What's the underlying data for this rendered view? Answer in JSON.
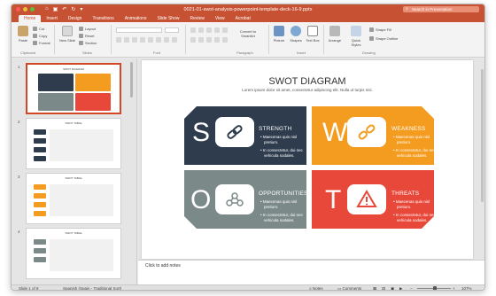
{
  "window": {
    "title": "0021-01-swot-analysis-powerpoint-template-deck-16-9.pptx",
    "search_placeholder": "Search in Presentation"
  },
  "tabs": [
    "Home",
    "Insert",
    "Design",
    "Transitions",
    "Animations",
    "Slide Show",
    "Review",
    "View",
    "Acrobat"
  ],
  "active_tab": "Home",
  "ribbon": {
    "paste": "Paste",
    "cut": "Cut",
    "copy": "Copy",
    "format": "Format",
    "new_slide": "New Slide",
    "layout": "Layout",
    "reset": "Reset",
    "section": "Section",
    "convert_smartart": "Convert to SmartArt",
    "picture": "Picture",
    "shapes": "Shapes",
    "text_box": "Text Box",
    "arrange": "Arrange",
    "quick_styles": "Quick Styles",
    "shape_fill": "Shape Fill",
    "shape_outline": "Shape Outline",
    "groups": {
      "clipboard": "Clipboard",
      "slides": "Slides",
      "font": "Font",
      "paragraph": "Paragraph",
      "insert": "Insert",
      "drawing": "Drawing"
    }
  },
  "thumbnails": [
    {
      "num": "1",
      "title": "SWOT DIAGRAM"
    },
    {
      "num": "2",
      "title": "SWOT TABLE"
    },
    {
      "num": "3",
      "title": "SWOT TABLE"
    },
    {
      "num": "4",
      "title": "SWOT TABLE"
    }
  ],
  "slide": {
    "title": "SWOT DIAGRAM",
    "subtitle": "Lorem ipsum dolor sit amet, consectetur adipiscing elit. Nulla ut turpis nisi.",
    "cards": [
      {
        "letter": "S",
        "heading": "STRENGTH",
        "bullet1a": "Maecenas quis nisl",
        "bullet1b": "pretium.",
        "bullet2a": "In consectetur, dui nec",
        "bullet2b": "vehicula sodales.",
        "color": "#2e3c4e",
        "icon": "link-icon"
      },
      {
        "letter": "W",
        "heading": "WEAKNESS",
        "bullet1a": "Maecenas quis nisl",
        "bullet1b": "pretium.",
        "bullet2a": "In consectetur, dui nec",
        "bullet2b": "vehicula sodales.",
        "color": "#f39c1f",
        "icon": "broken-link-icon"
      },
      {
        "letter": "O",
        "heading": "OPPORTUNITIES",
        "bullet1a": "Maecenas quis nisl",
        "bullet1b": "pretium.",
        "bullet2a": "In consectetur, dui nec",
        "bullet2b": "vehicula sodales.",
        "color": "#7b8a88",
        "icon": "network-icon"
      },
      {
        "letter": "T",
        "heading": "THREATS",
        "bullet1a": "Maecenas quis nisl",
        "bullet1b": "pretium.",
        "bullet2a": "In consectetur, dui nec",
        "bullet2b": "vehicula sodales.",
        "color": "#e8483a",
        "icon": "warning-icon"
      }
    ]
  },
  "notes_placeholder": "Click to add notes",
  "status": {
    "slide_of": "Slide 1 of 8",
    "language": "Spanish (Spain - Traditional Sort)",
    "notes": "Notes",
    "comments": "Comments",
    "zoom": "107%"
  }
}
